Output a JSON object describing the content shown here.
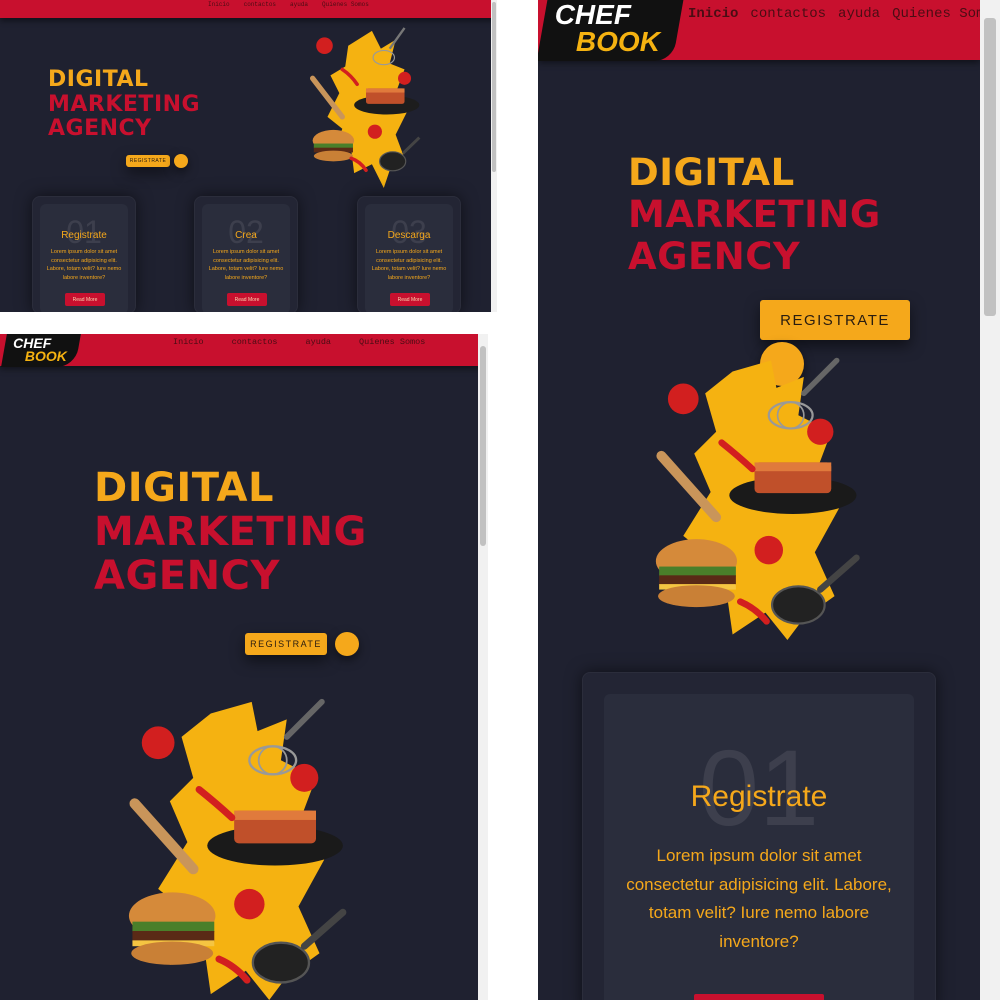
{
  "brand": {
    "line1": "CHEF",
    "line2": "BOOK"
  },
  "nav": [
    "Inicio",
    "contactos",
    "ayuda",
    "Quienes Somos"
  ],
  "hero": {
    "line1": "DIGITAL",
    "line2": "MARKETING",
    "line3": "AGENCY",
    "button": "REGISTRATE"
  },
  "cards": [
    {
      "number": "01",
      "title": "Registrate",
      "text": "Lorem ipsum dolor sit amet consectetur adipisicing elit. Labore, totam velit? Iure nemo labore inventore?",
      "button": "Read More"
    },
    {
      "number": "02",
      "title": "Crea",
      "text": "Lorem ipsum dolor sit amet consectetur adipisicing elit. Labore, totam velit? Iure nemo labore inventore?",
      "button": "Read More"
    },
    {
      "number": "03",
      "title": "Descarga",
      "text": "Lorem ipsum dolor sit amet consectetur adipisicing elit. Labore, totam velit? Iure nemo labore inventore?",
      "button": "Read More"
    }
  ],
  "colors": {
    "header": "#c8102e",
    "accent": "#f5a81b",
    "background": "#1f2130"
  },
  "illustration_icons": [
    "whisk-icon",
    "rolling-pin-icon",
    "lasagna-icon",
    "burger-icon",
    "tomato-icon",
    "chili-icon",
    "frying-pan-icon"
  ]
}
